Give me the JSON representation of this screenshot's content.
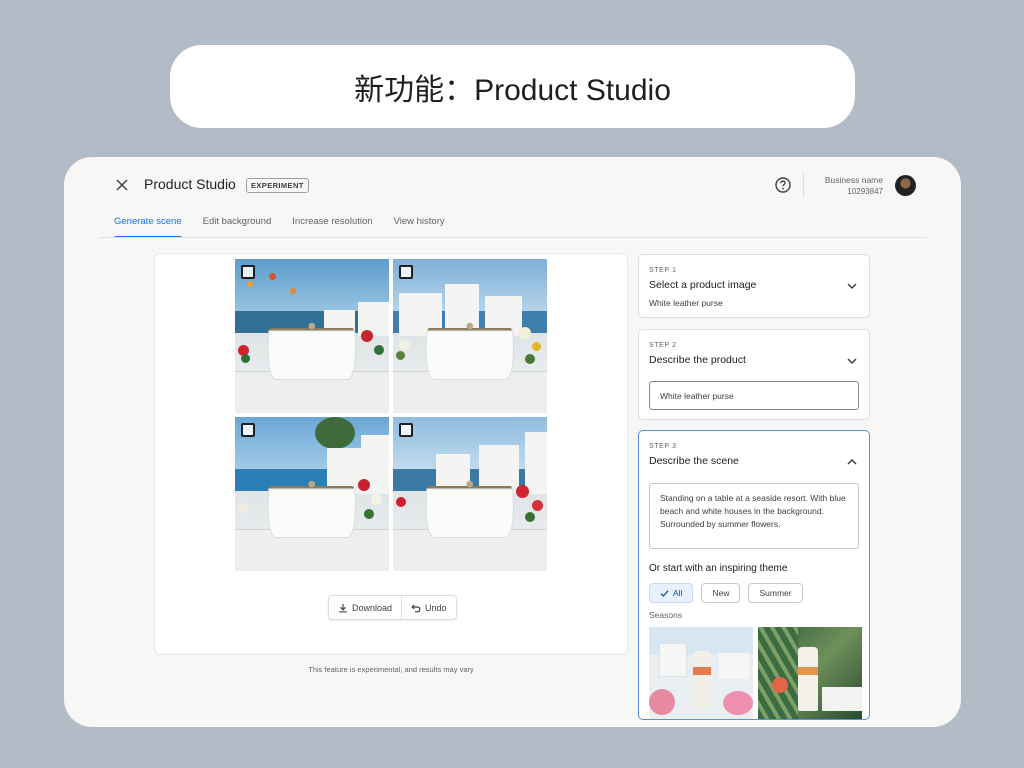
{
  "slide_title": "新功能：Product Studio",
  "header": {
    "close_icon": "close-icon",
    "app_title": "Product Studio",
    "badge": "EXPERIMENT",
    "help_icon": "help-circle-icon",
    "business_name": "Business name",
    "business_id": "10293847"
  },
  "tabs": [
    {
      "label": "Generate scene",
      "active": true
    },
    {
      "label": "Edit background",
      "active": false
    },
    {
      "label": "Increase resolution",
      "active": false
    },
    {
      "label": "View history",
      "active": false
    }
  ],
  "canvas": {
    "images": [
      {
        "name": "generated-image-1",
        "checked": false
      },
      {
        "name": "generated-image-2",
        "checked": false
      },
      {
        "name": "generated-image-3",
        "checked": false
      },
      {
        "name": "generated-image-4",
        "checked": false
      }
    ],
    "download_label": "Download",
    "undo_label": "Undo",
    "footnote": "This feature is experimental, and results may vary"
  },
  "steps": [
    {
      "label": "STEP 1",
      "title": "Select a product image",
      "value": "White leather purse",
      "expanded": false
    },
    {
      "label": "STEP 2",
      "title": "Describe the product",
      "value": "White leather purse",
      "expanded": false
    },
    {
      "label": "STEP 3",
      "title": "Describe the scene",
      "value": "Standing on a table at a seaside resort. With blue beach and white houses in the background. Surrounded by summer flowers.",
      "expanded": true
    }
  ],
  "theme": {
    "heading": "Or start with an inspiring theme",
    "chips": [
      {
        "label": "All",
        "selected": true
      },
      {
        "label": "New",
        "selected": false
      },
      {
        "label": "Summer",
        "selected": false
      }
    ],
    "section_label": "Seasons"
  },
  "colors": {
    "accent": "#1a73e8",
    "background": "#b3bcc6",
    "frame": "#f7f7f6"
  }
}
